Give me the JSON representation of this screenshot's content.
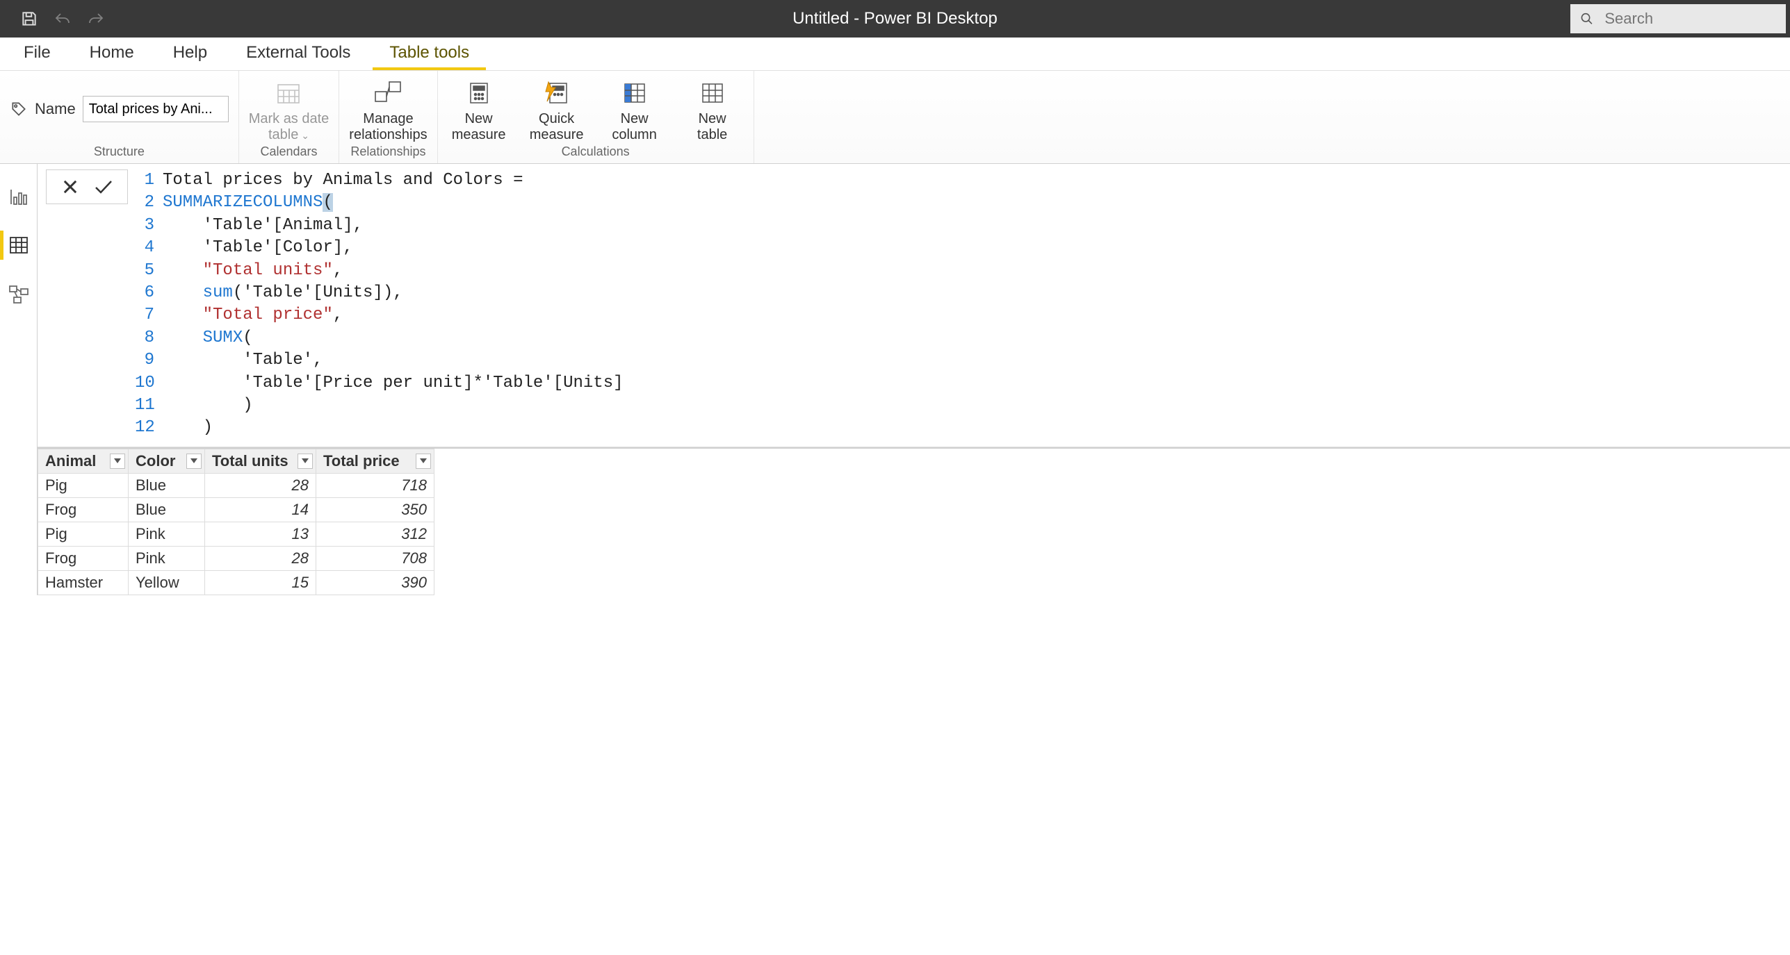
{
  "window_title": "Untitled - Power BI Desktop",
  "search_placeholder": "Search",
  "tabs": {
    "file": "File",
    "home": "Home",
    "help": "Help",
    "external_tools": "External Tools",
    "table_tools": "Table tools"
  },
  "ribbon": {
    "name_label": "Name",
    "name_value": "Total prices by Ani...",
    "mark_as_date": "Mark as date\ntable",
    "manage_rel": "Manage\nrelationships",
    "new_measure": "New\nmeasure",
    "quick_measure": "Quick\nmeasure",
    "new_column": "New\ncolumn",
    "new_table": "New\ntable",
    "group_structure": "Structure",
    "group_calendars": "Calendars",
    "group_relationships": "Relationships",
    "group_calculations": "Calculations"
  },
  "formula": {
    "lines": [
      {
        "n": "1",
        "tokens": [
          [
            "txt",
            "Total prices by Animals and Colors ="
          ]
        ]
      },
      {
        "n": "2",
        "tokens": [
          [
            "fn",
            "SUMMARIZECOLUMNS"
          ],
          [
            "brh",
            "("
          ]
        ]
      },
      {
        "n": "3",
        "tokens": [
          [
            "txt",
            "    'Table'[Animal],"
          ]
        ]
      },
      {
        "n": "4",
        "tokens": [
          [
            "txt",
            "    'Table'[Color],"
          ]
        ]
      },
      {
        "n": "5",
        "tokens": [
          [
            "txt",
            "    "
          ],
          [
            "str",
            "\"Total units\""
          ],
          [
            "txt",
            ","
          ]
        ]
      },
      {
        "n": "6",
        "tokens": [
          [
            "txt",
            "    "
          ],
          [
            "fn",
            "sum"
          ],
          [
            "txt",
            "('Table'[Units]),"
          ]
        ]
      },
      {
        "n": "7",
        "tokens": [
          [
            "txt",
            "    "
          ],
          [
            "str",
            "\"Total price\""
          ],
          [
            "txt",
            ","
          ]
        ]
      },
      {
        "n": "8",
        "tokens": [
          [
            "txt",
            "    "
          ],
          [
            "fn",
            "SUMX"
          ],
          [
            "txt",
            "("
          ]
        ]
      },
      {
        "n": "9",
        "tokens": [
          [
            "txt",
            "        'Table',"
          ]
        ]
      },
      {
        "n": "10",
        "tokens": [
          [
            "txt",
            "        'Table'[Price per unit]*'Table'[Units]"
          ]
        ]
      },
      {
        "n": "11",
        "tokens": [
          [
            "txt",
            "        )"
          ]
        ]
      },
      {
        "n": "12",
        "tokens": [
          [
            "txt",
            "    )"
          ]
        ]
      }
    ]
  },
  "table": {
    "headers": [
      "Animal",
      "Color",
      "Total units",
      "Total price"
    ],
    "rows": [
      [
        "Pig",
        "Blue",
        "28",
        "718"
      ],
      [
        "Frog",
        "Blue",
        "14",
        "350"
      ],
      [
        "Pig",
        "Pink",
        "13",
        "312"
      ],
      [
        "Frog",
        "Pink",
        "28",
        "708"
      ],
      [
        "Hamster",
        "Yellow",
        "15",
        "390"
      ]
    ]
  }
}
